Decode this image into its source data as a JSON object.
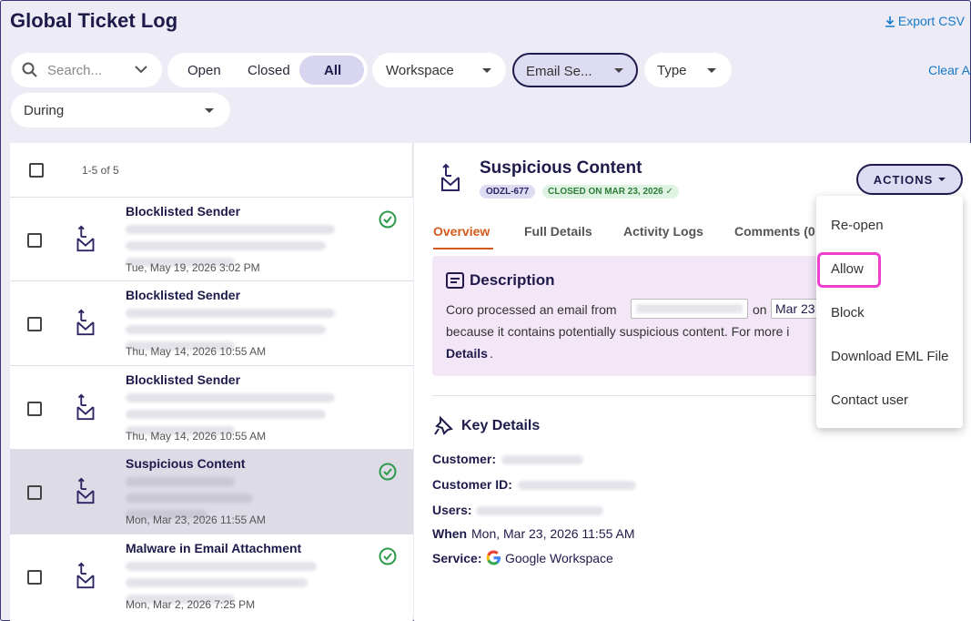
{
  "page": {
    "title": "Global Ticket Log",
    "export_label": "Export CSV"
  },
  "filters": {
    "search_placeholder": "Search...",
    "status_segments": [
      "Open",
      "Closed",
      "All"
    ],
    "workspace": "Workspace",
    "email_sec": "Email Se...",
    "type": "Type",
    "clear": "Clear A",
    "during": "During"
  },
  "list": {
    "count": "1-5 of 5",
    "rows": [
      {
        "title": "Blocklisted Sender",
        "date": "Tue, May 19, 2026 3:02 PM",
        "resolved": true
      },
      {
        "title": "Blocklisted Sender",
        "date": "Thu, May 14, 2026 10:55 AM",
        "resolved": false
      },
      {
        "title": "Blocklisted Sender",
        "date": "Thu, May 14, 2026 10:55 AM",
        "resolved": false
      },
      {
        "title": "Suspicious Content",
        "date": "Mon, Mar 23, 2026 11:55 AM",
        "resolved": true
      },
      {
        "title": "Malware in Email Attachment",
        "date": "Mon, Mar 2, 2026 7:25 PM",
        "resolved": true
      }
    ]
  },
  "detail": {
    "title": "Suspicious Content",
    "ticket_id": "ODZL-677",
    "status_badge": "CLOSED ON MAR 23, 2026 ✓",
    "actions_label": "ACTIONS",
    "tabs": [
      "Overview",
      "Full Details",
      "Activity Logs",
      "Comments (0"
    ],
    "description_heading": "Description",
    "desc_line1_a": "Coro processed an email from",
    "desc_line1_b": "on",
    "desc_line1_c": "Mar 23,",
    "desc_line2": "because it contains potentially suspicious content. For more i",
    "desc_line3": "Details",
    "desc_line3_end": ".",
    "key_details_heading": "Key Details",
    "customer_label": "Customer:",
    "customer_id_label": "Customer ID:",
    "users_label": "Users:",
    "when_label": "When",
    "when_value": "Mon, Mar 23, 2026 11:55 AM",
    "service_label": "Service:",
    "service_value": "Google Workspace"
  },
  "actions_menu": [
    "Re-open",
    "Allow",
    "Block",
    "Download EML File",
    "Contact user"
  ],
  "colors": {
    "accent_orange": "#d35a1a",
    "link_blue": "#1478c8",
    "highlight_pink": "#ee3fcf",
    "resolved_green": "#2e9a4a"
  }
}
